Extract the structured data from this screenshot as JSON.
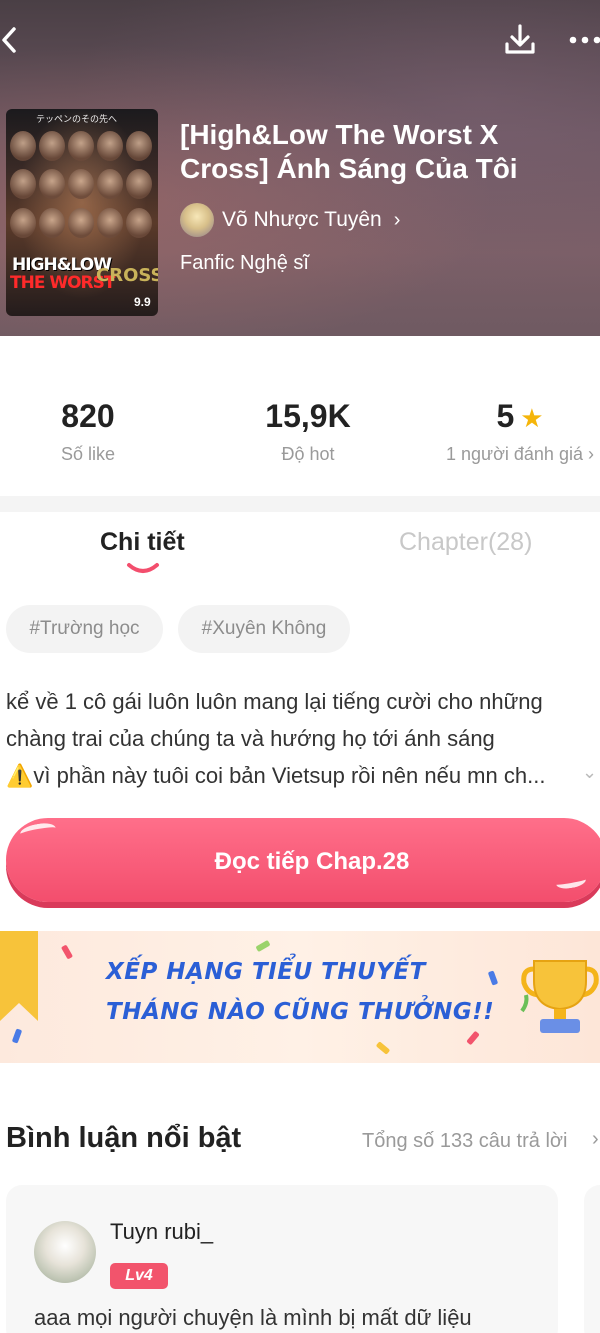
{
  "header": {
    "title": "[High&Low The Worst X Cross] Ánh Sáng Của Tôi",
    "author": "Võ Nhược Tuyên",
    "genre": "Fanfic Nghệ sĩ",
    "cover_texts": {
      "top": "テッペンのその先へ",
      "logo_line1": "HIGH&LOW",
      "logo_line2": "THE WORST",
      "logo_line3": "CROSS",
      "release": "9.9"
    },
    "icons": [
      "back-icon",
      "download-icon",
      "more-icon"
    ]
  },
  "stats": {
    "likes": {
      "value": "820",
      "label": "Số like"
    },
    "hot": {
      "value": "15,9K",
      "label": "Độ hot"
    },
    "rating": {
      "value": "5",
      "label": "1 người đánh giá"
    }
  },
  "tabs": {
    "detail": "Chi tiết",
    "chapter": "Chapter(28)"
  },
  "tags": [
    "#Trường học",
    "#Xuyên Không"
  ],
  "description": {
    "line1": "kể về 1 cô gái luôn luôn mang lại tiếng cười cho những",
    "line2": "chàng trai của chúng ta và hướng họ tới ánh sáng",
    "line3": "⚠️vì phần này tuôi coi bản Vietsup rồi nên nếu mn ch..."
  },
  "cta": {
    "label": "Đọc tiếp Chap.28"
  },
  "banner": {
    "line1": "XẾP HẠNG TIỂU THUYẾT",
    "line2": "THÁNG NÀO CŨNG THƯỞNG!!"
  },
  "comments": {
    "title": "Bình luận nổi bật",
    "total": "Tổng số 133 câu trả lời",
    "items": [
      {
        "user": "Tuyn rubi_",
        "level": "Lv4",
        "text": "aaa mọi người chuyện là mình bị mất dữ liệu"
      }
    ]
  },
  "colors": {
    "accent": "#f34e6d",
    "star": "#f5b50a",
    "banner_text": "#2b5fd6"
  }
}
